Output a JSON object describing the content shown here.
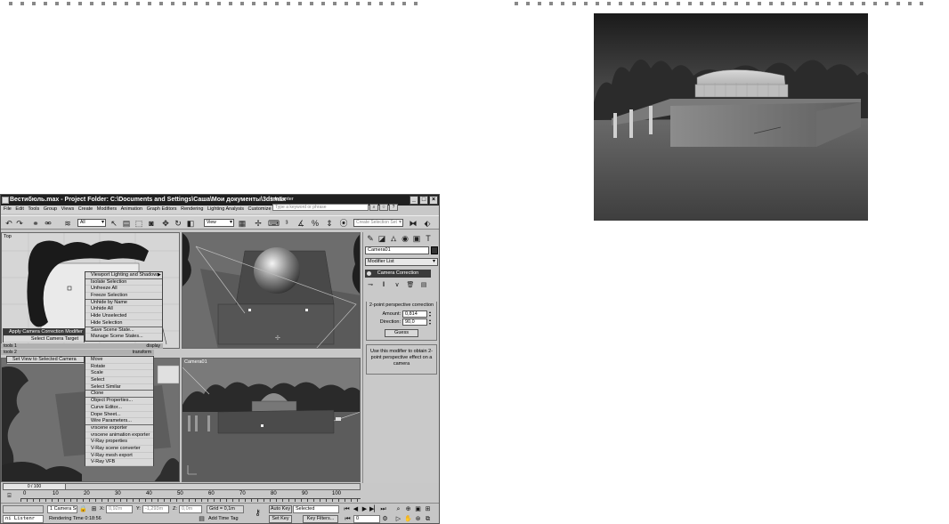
{
  "window": {
    "title": "Вестибюль.max    - Project Folder: C:\\Documents and Settings\\Саша\\Мои документы\\3dsmax",
    "infocenter_label": "InfoCenter",
    "search_placeholder": "Type a keyword or phrase"
  },
  "menu": [
    "File",
    "Edit",
    "Tools",
    "Group",
    "Views",
    "Create",
    "Modifiers",
    "Animation",
    "Graph Editors",
    "Rendering",
    "Lighting Analysis",
    "Customize"
  ],
  "toolbar": {
    "filter_value": "All",
    "refcoord_value": "View",
    "selection_set_placeholder": "Create Selection Set"
  },
  "viewports": {
    "top": "Top",
    "camera": "Camera01"
  },
  "quad_menu": {
    "upper_right": [
      "Viewport Lighting and Shadows",
      "Isolate Selection",
      "Unfreeze All",
      "Freeze Selection",
      "Unhide by Name",
      "Unhide All",
      "Hide Unselected",
      "Hide Selection",
      "Save Scene State...",
      "Manage Scene States..."
    ],
    "upper_left": [
      "Apply Camera Correction Modifier",
      "Select Camera Target"
    ],
    "left_header_top": "tools 1",
    "left_header_bottom": "tools 2",
    "right_header_top": "display",
    "right_header_bottom": "transform",
    "lower_left": [
      "Set View to Selected Camera"
    ],
    "lower_right": [
      "Move",
      "Rotate",
      "Scale",
      "Select",
      "Select Similar",
      "Clone",
      "Object Properties...",
      "Curve Editor...",
      "Dope Sheet...",
      "Wire Parameters...",
      "vrscene exporter",
      "vrscene animation exporter",
      "V-Ray properties",
      "V-Ray scene converter",
      "V-Ray mesh export",
      "V-Ray VFB"
    ]
  },
  "command_panel": {
    "object_name": "Camera01",
    "modifier_list": "Modifier List",
    "stack_item": "Camera Correction",
    "rollout_title": "2-point perspective correction",
    "amount_label": "Amount:",
    "amount_value": "0,814",
    "direction_label": "Direction:",
    "direction_value": "90,0",
    "guess_label": "Guess",
    "info_text": "Use this modifier to obtain 2-point perspective effect on a camera"
  },
  "timeline": {
    "frame_display": "0 / 100",
    "ticks": [
      "0",
      "10",
      "20",
      "30",
      "40",
      "50",
      "60",
      "70",
      "80",
      "90",
      "100"
    ]
  },
  "status": {
    "listener": "ni Listenr",
    "selection": "1 Camera Sel",
    "x_label": "X:",
    "x_value": "0,92m",
    "y_label": "Y:",
    "y_value": "-1,293m",
    "z_label": "Z:",
    "z_value": "0,0m",
    "grid": "Grid = 0,1m",
    "autokey": "Auto Key",
    "selected": "Selected",
    "setkey": "Set Key",
    "keyfilters": "Key Filters...",
    "frame": "0",
    "rendering_time": "Rendering Time  0:18:56",
    "add_time_tag": "Add Time Tag"
  }
}
